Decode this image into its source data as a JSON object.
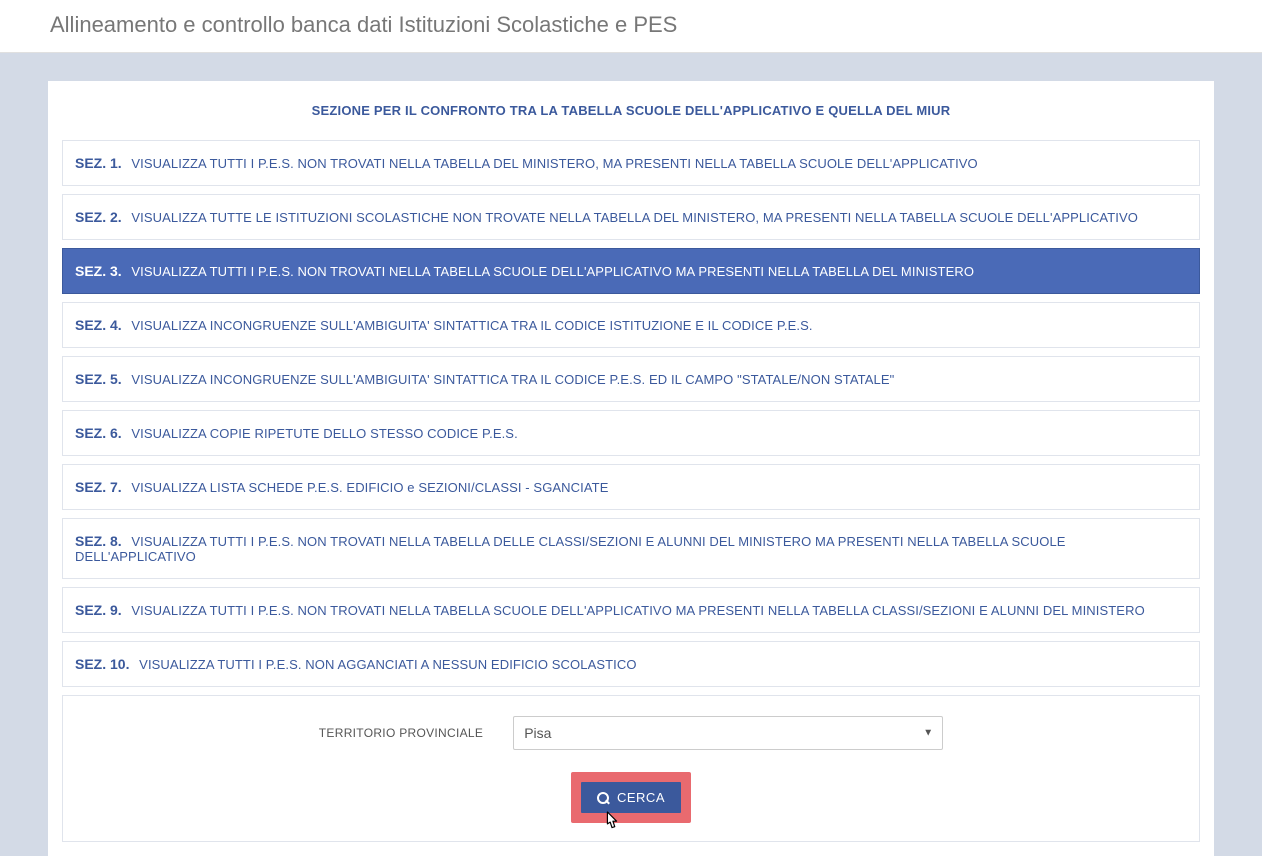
{
  "header": {
    "title": "Allineamento e controllo banca dati Istituzioni Scolastiche e PES"
  },
  "main": {
    "section_heading": "SEZIONE PER IL CONFRONTO TRA LA TABELLA SCUOLE DELL'APPLICATIVO E QUELLA DEL MIUR",
    "sections": [
      {
        "prefix": "SEZ. 1.",
        "text": "VISUALIZZA TUTTI I P.E.S. NON TROVATI NELLA TABELLA DEL MINISTERO, MA PRESENTI NELLA TABELLA SCUOLE DELL'APPLICATIVO",
        "active": false
      },
      {
        "prefix": "SEZ. 2.",
        "text": "VISUALIZZA TUTTE LE ISTITUZIONI SCOLASTICHE NON TROVATE NELLA TABELLA DEL MINISTERO, MA PRESENTI NELLA TABELLA SCUOLE DELL'APPLICATIVO",
        "active": false
      },
      {
        "prefix": "SEZ. 3.",
        "text": "VISUALIZZA TUTTI I P.E.S. NON TROVATI NELLA TABELLA SCUOLE DELL'APPLICATIVO MA PRESENTI NELLA TABELLA DEL MINISTERO",
        "active": true
      },
      {
        "prefix": "SEZ. 4.",
        "text": "VISUALIZZA INCONGRUENZE SULL'AMBIGUITA' SINTATTICA TRA IL CODICE ISTITUZIONE E IL CODICE P.E.S.",
        "active": false
      },
      {
        "prefix": "SEZ. 5.",
        "text": "VISUALIZZA INCONGRUENZE SULL'AMBIGUITA' SINTATTICA TRA IL CODICE P.E.S. ED IL CAMPO \"STATALE/NON STATALE\"",
        "active": false
      },
      {
        "prefix": "SEZ. 6.",
        "text": "VISUALIZZA COPIE RIPETUTE DELLO STESSO CODICE P.E.S.",
        "active": false
      },
      {
        "prefix": "SEZ. 7.",
        "text": "VISUALIZZA LISTA SCHEDE P.E.S. EDIFICIO e SEZIONI/CLASSI - SGANCIATE",
        "active": false
      },
      {
        "prefix": "SEZ. 8.",
        "text": "VISUALIZZA TUTTI I P.E.S. NON TROVATI NELLA TABELLA DELLE CLASSI/SEZIONI E ALUNNI DEL MINISTERO MA PRESENTI NELLA TABELLA SCUOLE DELL'APPLICATIVO",
        "active": false
      },
      {
        "prefix": "SEZ. 9.",
        "text": "VISUALIZZA TUTTI I P.E.S. NON TROVATI NELLA TABELLA SCUOLE DELL'APPLICATIVO MA PRESENTI NELLA TABELLA CLASSI/SEZIONI E ALUNNI DEL MINISTERO",
        "active": false
      },
      {
        "prefix": "SEZ. 10.",
        "text": "VISUALIZZA TUTTI I P.E.S. NON AGGANCIATI A NESSUN EDIFICIO SCOLASTICO",
        "active": false
      }
    ],
    "filter": {
      "label": "TERRITORIO PROVINCIALE",
      "selected": "Pisa",
      "options": [
        "Pisa"
      ]
    },
    "search_button": "CERCA"
  }
}
